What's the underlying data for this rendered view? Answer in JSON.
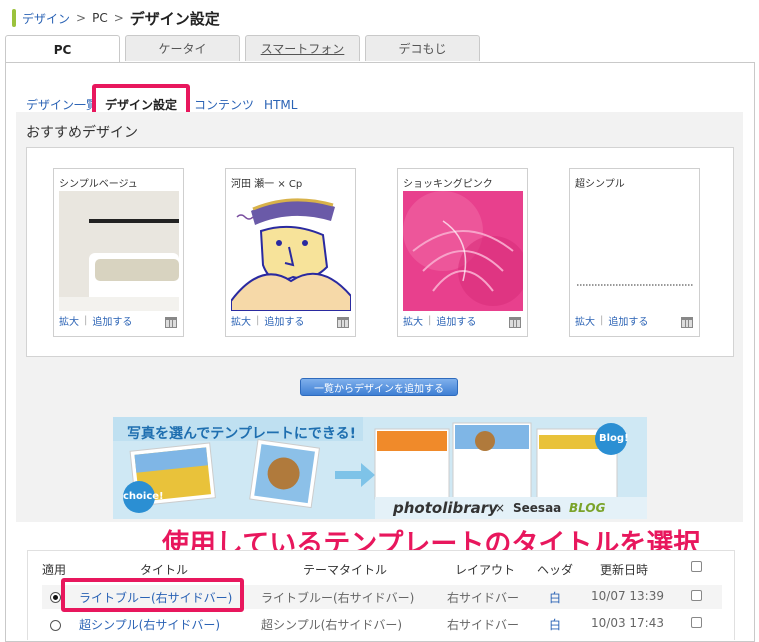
{
  "breadcrumb": {
    "items": [
      "デザイン",
      "PC"
    ],
    "separator": ">",
    "current": "デザイン設定"
  },
  "tabs": [
    {
      "label": "PC",
      "active": true
    },
    {
      "label": "ケータイ",
      "active": false
    },
    {
      "label": "スマートフォン",
      "active": false
    },
    {
      "label": "デコもじ",
      "active": false
    }
  ],
  "subnav": {
    "items": [
      "デザイン一覧",
      "デザイン設定",
      "コンテンツ",
      "HTML"
    ],
    "current": "デザイン設定"
  },
  "recommended": {
    "title": "おすすめデザイン",
    "cards": [
      {
        "name": "シンプルベージュ",
        "zoom": "拡大",
        "add": "追加する",
        "icon": "grid-icon"
      },
      {
        "name": "河田 瀬一 × Cp",
        "zoom": "拡大",
        "add": "追加する",
        "icon": "grid-icon"
      },
      {
        "name": "ショッキングピンク",
        "zoom": "拡大",
        "add": "追加する",
        "icon": "grid-icon"
      },
      {
        "name": "超シンプル",
        "zoom": "拡大",
        "add": "追加する",
        "icon": "grid-icon"
      }
    ],
    "add_button": "一覧からデザインを追加する"
  },
  "banner": {
    "headline": "写真を選んでテンプレートにできる!",
    "badge_left": "choice!",
    "badge_right": "Blog!",
    "brand1": "photolibrary",
    "times": "×",
    "brand2": "Seesaa",
    "brand3": "BLOG"
  },
  "annotation": "使用しているテンプレートのタイトルを選択",
  "table": {
    "headers": [
      "適用",
      "タイトル",
      "テーマタイトル",
      "レイアウト",
      "ヘッダ",
      "更新日時"
    ],
    "rows": [
      {
        "applied": true,
        "title": "ライトブルー(右サイドバー)",
        "theme": "ライトブルー(右サイドバー)",
        "layout": "右サイドバー",
        "header": "白",
        "updated": "10/07 13:39"
      },
      {
        "applied": false,
        "title": "超シンプル(右サイドバー)",
        "theme": "超シンプル(右サイドバー)",
        "layout": "右サイドバー",
        "header": "白",
        "updated": "10/03 17:43"
      }
    ]
  },
  "colors": {
    "accent": "#e8175d",
    "link": "#2b63b5",
    "breadcrumb_bar": "#9bc23c",
    "button": "#3f7fd4"
  }
}
